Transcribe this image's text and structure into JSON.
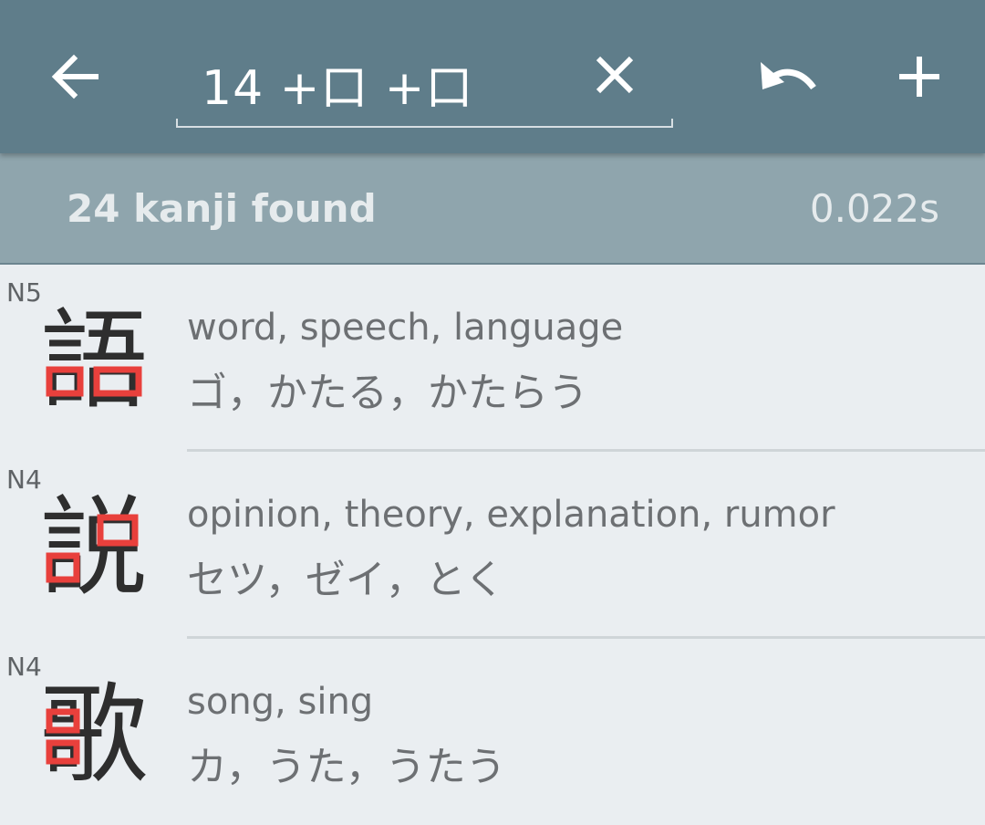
{
  "toolbar": {
    "query": "14 +口 +口"
  },
  "summary": {
    "count_text": "24 kanji found",
    "time_text": "0.022s"
  },
  "results": [
    {
      "level": "N5",
      "kanji": "語",
      "meaning": "word, speech, language",
      "reading": "ゴ，かたる，かたらう"
    },
    {
      "level": "N4",
      "kanji": "説",
      "meaning": "opinion, theory, explanation, rumor",
      "reading": "セツ，ゼイ，とく"
    },
    {
      "level": "N4",
      "kanji": "歌",
      "meaning": "song, sing",
      "reading": "カ，うた，うたう"
    }
  ],
  "icons": {
    "back": "arrow-left-icon",
    "clear": "close-icon",
    "undo": "undo-icon",
    "add": "plus-icon"
  },
  "colors": {
    "appbar": "#5f7d8a",
    "subbar": "#8fa5ad",
    "background": "#eaeef1",
    "highlight": "#e8403c",
    "kanji": "#2e2e2e"
  }
}
